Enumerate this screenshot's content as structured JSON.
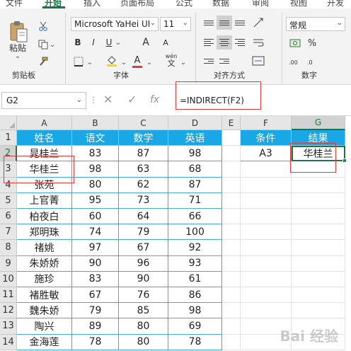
{
  "ribbon": {
    "tabs": [
      "文件",
      "开始",
      "插入",
      "页面布局",
      "公式",
      "数据",
      "审阅",
      "视图",
      "开发"
    ],
    "active_tab": 1,
    "clipboard": {
      "paste_label": "粘贴",
      "group_label": "剪贴板"
    },
    "font": {
      "name": "Microsoft YaHei UI",
      "size": "11",
      "bold": "B",
      "italic": "I",
      "underline": "U",
      "grow": "A",
      "shrink": "A",
      "color_letter": "A",
      "phonetic": "wén",
      "group_label": "字体"
    },
    "alignment": {
      "group_label": "对齐方式"
    },
    "number": {
      "format": "常规",
      "percent": "%",
      "group_label": "数字"
    },
    "colors": {
      "accent": "#217346",
      "font_red": "#e03b3b",
      "fill_yellow": "#ffd800"
    }
  },
  "formula_bar": {
    "name_box": "G2",
    "cancel_icon": "close-icon",
    "enter_icon": "check-icon",
    "fx": "fx",
    "formula": "=INDIRECT(F2)"
  },
  "grid": {
    "columns": [
      "A",
      "B",
      "C",
      "D",
      "E",
      "F",
      "G"
    ],
    "rows": [
      "1",
      "2",
      "3",
      "4",
      "5",
      "6",
      "7",
      "8",
      "9",
      "10",
      "11",
      "12",
      "13",
      "14"
    ],
    "table_headers": [
      "姓名",
      "语文",
      "数学",
      "英语"
    ],
    "table_rows": [
      [
        "晁桂兰",
        "83",
        "87",
        "98"
      ],
      [
        "华桂兰",
        "98",
        "63",
        "68"
      ],
      [
        "张苑",
        "80",
        "62",
        "87"
      ],
      [
        "上官菁",
        "95",
        "73",
        "71"
      ],
      [
        "柏夜白",
        "60",
        "64",
        "66"
      ],
      [
        "郑明珠",
        "74",
        "79",
        "100"
      ],
      [
        "禇姚",
        "97",
        "67",
        "92"
      ],
      [
        "朱娇娇",
        "90",
        "96",
        "93"
      ],
      [
        "施珍",
        "83",
        "90",
        "61"
      ],
      [
        "褚胜敏",
        "67",
        "76",
        "86"
      ],
      [
        "魏朱娇",
        "79",
        "85",
        "98"
      ],
      [
        "陶兴",
        "89",
        "80",
        "69"
      ],
      [
        "金海莲",
        "78",
        "80",
        "78"
      ]
    ],
    "lookup_headers": [
      "条件",
      "结果"
    ],
    "lookup_values": [
      "A3",
      "华桂兰"
    ],
    "selected_cell": "G2",
    "header_color": "#19a7e6"
  },
  "watermark": "Bai 经验"
}
